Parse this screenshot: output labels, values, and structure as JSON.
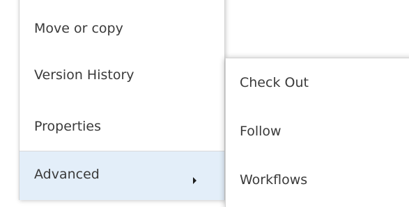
{
  "context_menu": {
    "items": [
      {
        "label": "Move or copy"
      },
      {
        "label": "Version History"
      },
      {
        "label": "Properties"
      },
      {
        "label": "Advanced",
        "has_submenu": true,
        "highlighted": true
      }
    ]
  },
  "advanced_submenu": {
    "items": [
      {
        "label": "Check Out"
      },
      {
        "label": "Follow"
      },
      {
        "label": "Workflows"
      }
    ]
  },
  "colors": {
    "highlight": "#e3eef9",
    "text": "#3a3a3a",
    "border": "#d4d4d4"
  },
  "icons": {
    "submenu_arrow": "chevron-right-icon"
  }
}
